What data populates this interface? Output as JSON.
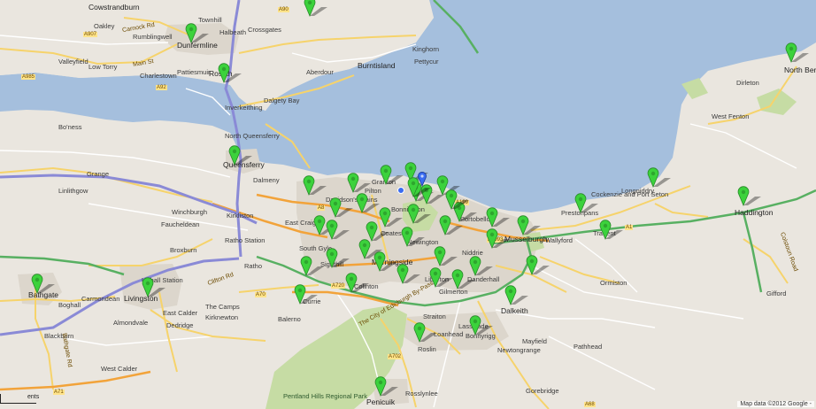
{
  "map": {
    "attribution": "Map data ©2012 Google -",
    "scale_label": "ents"
  },
  "places": [
    {
      "text": "Cowstrandburn",
      "cls": "town"
    },
    {
      "text": "Oakley",
      "cls": ""
    },
    {
      "text": "Rumblingwell",
      "cls": ""
    },
    {
      "text": "Townhill",
      "cls": ""
    },
    {
      "text": "Halbeath",
      "cls": ""
    },
    {
      "text": "Crossgates",
      "cls": ""
    },
    {
      "text": "Dunfermline",
      "cls": "town"
    },
    {
      "text": "Valleyfield",
      "cls": ""
    },
    {
      "text": "Low Torry",
      "cls": ""
    },
    {
      "text": "Pattiesmuir",
      "cls": ""
    },
    {
      "text": "Rosyth",
      "cls": "town"
    },
    {
      "text": "Charlestown",
      "cls": ""
    },
    {
      "text": "Inverkeithing",
      "cls": ""
    },
    {
      "text": "Dalgety Bay",
      "cls": ""
    },
    {
      "text": "Aberdour",
      "cls": ""
    },
    {
      "text": "Burntisland",
      "cls": "town"
    },
    {
      "text": "Kinghorn",
      "cls": ""
    },
    {
      "text": "Pettycur",
      "cls": ""
    },
    {
      "text": "North Queensferry",
      "cls": ""
    },
    {
      "text": "Queensferry",
      "cls": "town"
    },
    {
      "text": "Dalmeny",
      "cls": ""
    },
    {
      "text": "Bo'ness",
      "cls": ""
    },
    {
      "text": "Grange",
      "cls": ""
    },
    {
      "text": "Linlithgow",
      "cls": ""
    },
    {
      "text": "Winchburgh",
      "cls": ""
    },
    {
      "text": "Kirkliston",
      "cls": ""
    },
    {
      "text": "Faucheldean",
      "cls": ""
    },
    {
      "text": "Broxburn",
      "cls": ""
    },
    {
      "text": "Ratho Station",
      "cls": ""
    },
    {
      "text": "Ratho",
      "cls": ""
    },
    {
      "text": "East Craigs",
      "cls": ""
    },
    {
      "text": "Davidson's Mains",
      "cls": ""
    },
    {
      "text": "Pilton",
      "cls": ""
    },
    {
      "text": "Granton",
      "cls": ""
    },
    {
      "text": "Bonnington",
      "cls": ""
    },
    {
      "text": "Coates",
      "cls": ""
    },
    {
      "text": "Newington",
      "cls": ""
    },
    {
      "text": "Portobello",
      "cls": ""
    },
    {
      "text": "Musselburgh",
      "cls": "town"
    },
    {
      "text": "Niddrie",
      "cls": ""
    },
    {
      "text": "Prestonpans",
      "cls": ""
    },
    {
      "text": "Cockenzie and Port Seton",
      "cls": ""
    },
    {
      "text": "Longniddry",
      "cls": ""
    },
    {
      "text": "Tranent",
      "cls": ""
    },
    {
      "text": "Wallyford",
      "cls": ""
    },
    {
      "text": "South Gyle",
      "cls": ""
    },
    {
      "text": "Sighthill",
      "cls": ""
    },
    {
      "text": "Morningside",
      "cls": "town"
    },
    {
      "text": "Liberton",
      "cls": ""
    },
    {
      "text": "Danderhall",
      "cls": ""
    },
    {
      "text": "Gilmerton",
      "cls": ""
    },
    {
      "text": "Colinton",
      "cls": ""
    },
    {
      "text": "Currie",
      "cls": ""
    },
    {
      "text": "Balerno",
      "cls": ""
    },
    {
      "text": "Dalkeith",
      "cls": "town"
    },
    {
      "text": "Loanhead",
      "cls": ""
    },
    {
      "text": "Bonnyrigg",
      "cls": ""
    },
    {
      "text": "Straiton",
      "cls": ""
    },
    {
      "text": "Lasswade",
      "cls": ""
    },
    {
      "text": "Mayfield",
      "cls": ""
    },
    {
      "text": "Newtongrange",
      "cls": ""
    },
    {
      "text": "Gorebridge",
      "cls": ""
    },
    {
      "text": "Roslin",
      "cls": ""
    },
    {
      "text": "Rosslynlee",
      "cls": ""
    },
    {
      "text": "Penicuik",
      "cls": "town"
    },
    {
      "text": "Bathgate",
      "cls": "town"
    },
    {
      "text": "Livingston",
      "cls": "town"
    },
    {
      "text": "Uphall Station",
      "cls": ""
    },
    {
      "text": "Carmondean",
      "cls": ""
    },
    {
      "text": "Boghall",
      "cls": ""
    },
    {
      "text": "Almondvale",
      "cls": ""
    },
    {
      "text": "East Calder",
      "cls": ""
    },
    {
      "text": "The Camps",
      "cls": ""
    },
    {
      "text": "Dedridge",
      "cls": ""
    },
    {
      "text": "Kirknewton",
      "cls": ""
    },
    {
      "text": "Blackburn",
      "cls": ""
    },
    {
      "text": "West Calder",
      "cls": ""
    },
    {
      "text": "Haddington",
      "cls": "town"
    },
    {
      "text": "North Berwick",
      "cls": "town"
    },
    {
      "text": "Dirleton",
      "cls": ""
    },
    {
      "text": "West Fenton",
      "cls": ""
    },
    {
      "text": "Ormiston",
      "cls": ""
    },
    {
      "text": "Pathhead",
      "cls": ""
    },
    {
      "text": "Gifford",
      "cls": ""
    },
    {
      "text": "Pentland Hills Regional Park",
      "cls": "park"
    },
    {
      "text": "Carnock Rd",
      "cls": "roadtext"
    },
    {
      "text": "Main St",
      "cls": "roadtext"
    },
    {
      "text": "Clifton Rd",
      "cls": "roadtext"
    },
    {
      "text": "The City of Edinburgh By-Pass",
      "cls": "roadtext"
    },
    {
      "text": "Bathgate Rd",
      "cls": "roadtext"
    },
    {
      "text": "Colstoun Road",
      "cls": "roadtext"
    }
  ],
  "road_labels": [
    "A907",
    "A985",
    "A92",
    "A90",
    "A8",
    "A720",
    "A71",
    "A70",
    "A702",
    "A1",
    "A199",
    "A68",
    "A6093"
  ],
  "markers": [
    {
      "name": "marker",
      "color": "#3cd23c"
    },
    {
      "name": "current-location",
      "color": "#3a6cf0"
    }
  ]
}
